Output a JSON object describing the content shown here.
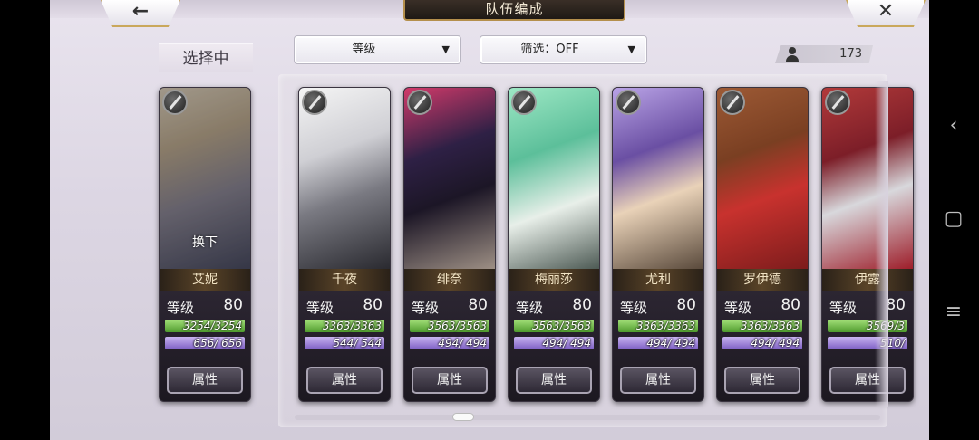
{
  "header": {
    "title": "队伍编成",
    "back_icon": "←",
    "close_icon": "✕"
  },
  "selecting": {
    "label": "选择中"
  },
  "toolbar": {
    "sort_label": "等级",
    "filter_label": "筛选：OFF",
    "dropdown_arrow": "▼",
    "unit_count": "173"
  },
  "selected_card": {
    "name": "艾妮",
    "swap_label": "换下",
    "level_label": "等级",
    "level": "80",
    "hp": "3254/3254",
    "sp": "656/ 656",
    "attr_label": "属性"
  },
  "cards": [
    {
      "name": "千夜",
      "level_label": "等级",
      "level": "80",
      "hp": "3363/3363",
      "sp": "544/ 544",
      "attr_label": "属性"
    },
    {
      "name": "绯奈",
      "level_label": "等级",
      "level": "80",
      "hp": "3563/3563",
      "sp": "494/ 494",
      "attr_label": "属性"
    },
    {
      "name": "梅丽莎",
      "level_label": "等级",
      "level": "80",
      "hp": "3563/3563",
      "sp": "494/ 494",
      "attr_label": "属性"
    },
    {
      "name": "尤利",
      "level_label": "等级",
      "level": "80",
      "hp": "3363/3363",
      "sp": "494/ 494",
      "attr_label": "属性"
    },
    {
      "name": "罗伊德",
      "level_label": "等级",
      "level": "80",
      "hp": "3363/3363",
      "sp": "494/ 494",
      "attr_label": "属性"
    },
    {
      "name": "伊露",
      "level_label": "等级",
      "level": "80",
      "hp": "3569/3",
      "sp": "510/",
      "attr_label": "属性"
    }
  ],
  "system_nav": {
    "back": "‹",
    "home": "▢",
    "menu": "≡"
  }
}
